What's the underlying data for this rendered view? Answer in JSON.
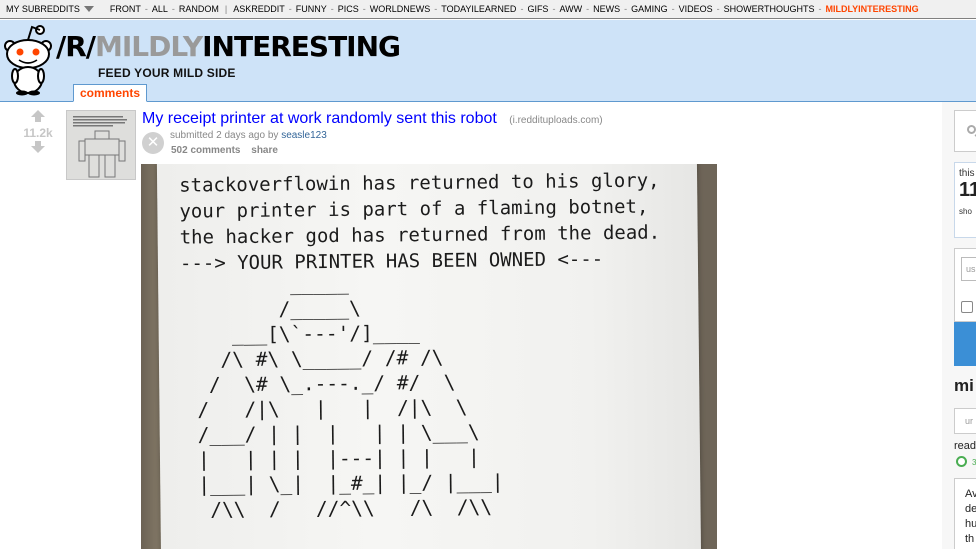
{
  "topbar": {
    "my_subreddits": "MY SUBREDDITS",
    "links": [
      "FRONT",
      "ALL",
      "RANDOM"
    ],
    "subreddits": [
      "ASKREDDIT",
      "FUNNY",
      "PICS",
      "WORLDNEWS",
      "TODAYILEARNED",
      "GIFS",
      "AWW",
      "NEWS",
      "GAMING",
      "VIDEOS",
      "SHOWERTHOUGHTS",
      "MILDLYINTERESTING"
    ],
    "active_subreddit": "MILDLYINTERESTING",
    "active_color": "#ff4500"
  },
  "header": {
    "prefix": "/R/",
    "title_grey": "MILDLY",
    "title_black": "INTERESTING",
    "tagline": "FEED YOUR MILD SIDE",
    "tab": "comments",
    "bg_color": "#cee3f8"
  },
  "post": {
    "score": "11.2k",
    "title": "My receipt printer at work randomly sent this robot",
    "domain": "(i.reddituploads.com)",
    "submitted_prefix": "submitted 2 days ago by ",
    "author": "seasle123",
    "comments": "502 comments",
    "share": "share",
    "hide_symbol": "✕"
  },
  "receipt": {
    "lines": [
      "stackoverflowin has returned to his glory,",
      "your printer is part of a flaming botnet,",
      "the hacker god has returned from the dead.",
      "---> YOUR PRINTER HAS BEEN OWNED <---"
    ],
    "ascii": "        _____\n       /_____\\\n   ___[\\`---'/]____\n  /\\ #\\ \\_____/ /# /\\\n /  \\# \\_.---._/ #/  \\\n/   /|\\   |   |  /|\\  \\\n/___/ | |  |   | | \\___\\\n|   | | |  |---| | |   |\n|___| \\_|  |_#_| |_/ |___|\n /\\\\  /   //^\\\\   /\\  /\\\\"
  },
  "sidebar": {
    "box_label": "this",
    "box_number": "11",
    "box_small": "sho",
    "login_placeholder": "us",
    "name": "mi",
    "field2_placeholder": "ur",
    "read_label": "read",
    "dot_label": "3",
    "box3_text": "Av de hu th"
  }
}
